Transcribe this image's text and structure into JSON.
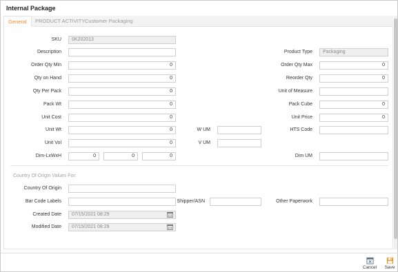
{
  "window": {
    "title": "Internal Package"
  },
  "tabs": [
    {
      "label": "General",
      "active": true
    },
    {
      "label": "PRODUCT ACTIVITY",
      "active": false
    },
    {
      "label": "Customer Packaging",
      "active": false
    }
  ],
  "fields": {
    "sku": {
      "label": "SKU",
      "value": "0K202013"
    },
    "description": {
      "label": "Description",
      "value": ""
    },
    "product_type": {
      "label": "Product Type",
      "value": "Packaging"
    },
    "order_qty_min": {
      "label": "Order Qty Min",
      "value": "0"
    },
    "order_qty_max": {
      "label": "Order Qty Max",
      "value": "0"
    },
    "qty_on_hand": {
      "label": "Qty on Hand",
      "value": "0"
    },
    "reorder_qty": {
      "label": "Reorder Qty",
      "value": "0"
    },
    "qty_per_pack": {
      "label": "Qty Per Pack",
      "value": "0"
    },
    "unit_of_measure": {
      "label": "Unit of Measure",
      "value": ""
    },
    "pack_wt": {
      "label": "Pack Wt",
      "value": "0"
    },
    "pack_cube": {
      "label": "Pack Cube",
      "value": "0"
    },
    "unit_cost": {
      "label": "Unit Cost",
      "value": "0"
    },
    "unit_price": {
      "label": "Unit Price",
      "value": "0"
    },
    "unit_wt": {
      "label": "Unit Wt",
      "value": "0"
    },
    "w_um": {
      "label": "W UM",
      "value": ""
    },
    "hts_code": {
      "label": "HTS Code",
      "value": ""
    },
    "unit_vol": {
      "label": "Unit Vol",
      "value": "0"
    },
    "v_um": {
      "label": "V UM",
      "value": ""
    },
    "dim_lxwxh": {
      "label": "Dim-LxWxH",
      "l": "0",
      "w": "0",
      "h": "0"
    },
    "dim_um": {
      "label": "Dim UM",
      "value": ""
    }
  },
  "origin_section": {
    "title": "Country Of Origin Values For:",
    "country_of_origin": {
      "label": "Country Of Origin",
      "value": ""
    },
    "bar_code_labels": {
      "label": "Bar Code Labels",
      "value": ""
    },
    "shipper_asn": {
      "label": "Shipper/ASN",
      "value": ""
    },
    "other_paperwork": {
      "label": "Other Paperwork",
      "value": ""
    },
    "created_date": {
      "label": "Created Date",
      "value": "07/15/2021 08:29"
    },
    "modified_date": {
      "label": "Modified Date",
      "value": "07/15/2021 08:29"
    }
  },
  "footer": {
    "cancel_label": "Cancel",
    "save_label": "Save"
  },
  "colors": {
    "accent": "#f08a2c",
    "save_icon": "#e8941f",
    "cancel_icon": "#5a6f8c"
  }
}
